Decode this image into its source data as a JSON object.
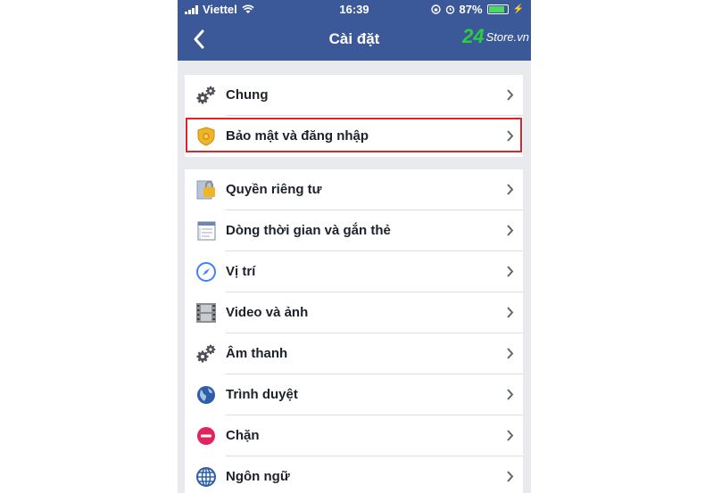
{
  "status_bar": {
    "carrier": "Viettel",
    "time": "16:39",
    "battery": "87%"
  },
  "nav": {
    "title": "Cài đặt"
  },
  "watermark": {
    "number": "24",
    "text": "Store.vn"
  },
  "groups": [
    {
      "items": [
        {
          "label": "Chung",
          "icon": "gears-icon"
        },
        {
          "label": "Bảo mật và đăng nhập",
          "icon": "shield-badge-icon",
          "highlighted": true
        }
      ]
    },
    {
      "items": [
        {
          "label": "Quyền riêng tư",
          "icon": "lock-icon"
        },
        {
          "label": "Dòng thời gian và gắn thẻ",
          "icon": "timeline-icon"
        },
        {
          "label": "Vị trí",
          "icon": "compass-icon"
        },
        {
          "label": "Video và ảnh",
          "icon": "film-icon"
        },
        {
          "label": "Âm thanh",
          "icon": "gears-icon"
        },
        {
          "label": "Trình duyệt",
          "icon": "globe-icon"
        },
        {
          "label": "Chặn",
          "icon": "block-icon"
        },
        {
          "label": "Ngôn ngữ",
          "icon": "language-globe-icon"
        }
      ]
    }
  ],
  "colors": {
    "navbar": "#3b5998",
    "highlight_border": "#d9262c"
  }
}
